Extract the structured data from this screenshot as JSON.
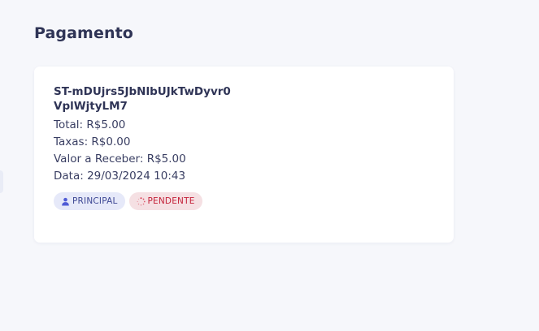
{
  "page": {
    "title": "Pagamento"
  },
  "payment": {
    "id": "ST-mDUjrs5JbNlbUJkTwDyvr0VplWjtyLM7",
    "total": "Total: R$5.00",
    "fees": "Taxas: R$0.00",
    "receivable": "Valor a Receber: R$5.00",
    "date": "Data: 29/03/2024 10:43",
    "badges": [
      {
        "label": "PRINCIPAL",
        "icon": "user-icon",
        "color": "#3d4794"
      },
      {
        "label": "PENDENTE",
        "icon": "spinner-icon",
        "color": "#c4223a"
      }
    ]
  }
}
